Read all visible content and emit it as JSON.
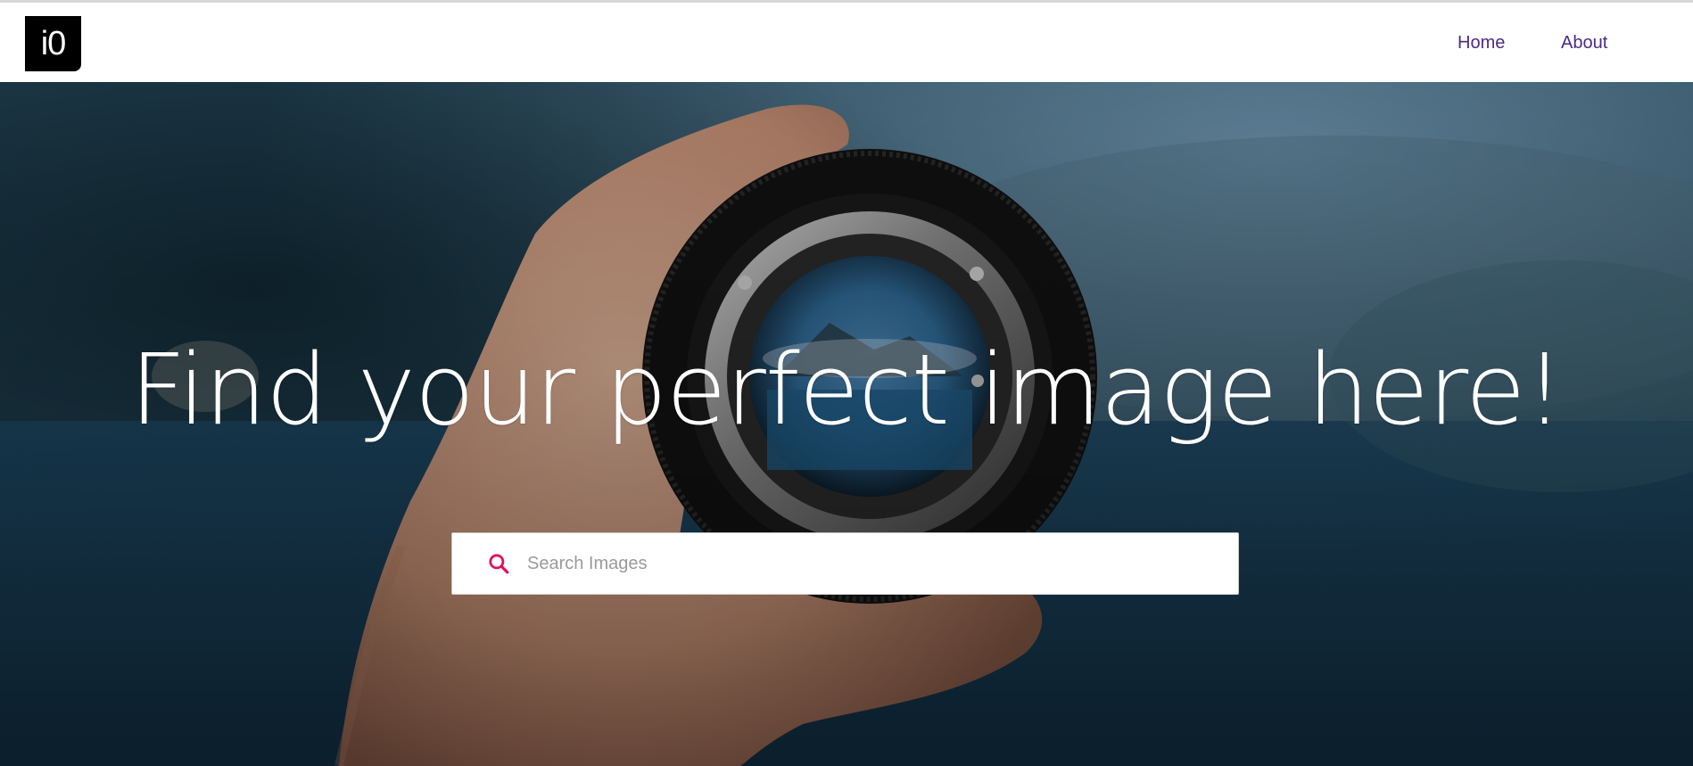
{
  "brand": {
    "logo_text": "i0"
  },
  "nav": {
    "items": [
      {
        "label": "Home"
      },
      {
        "label": "About"
      }
    ],
    "link_color": "#4b2a86"
  },
  "hero": {
    "headline": "Find your perfect image here!",
    "background_image": "hand-holding-camera-lens-over-lake-photo"
  },
  "search": {
    "placeholder": "Search Images",
    "value": "",
    "icon": "search-icon",
    "icon_color": "#e0115f"
  }
}
